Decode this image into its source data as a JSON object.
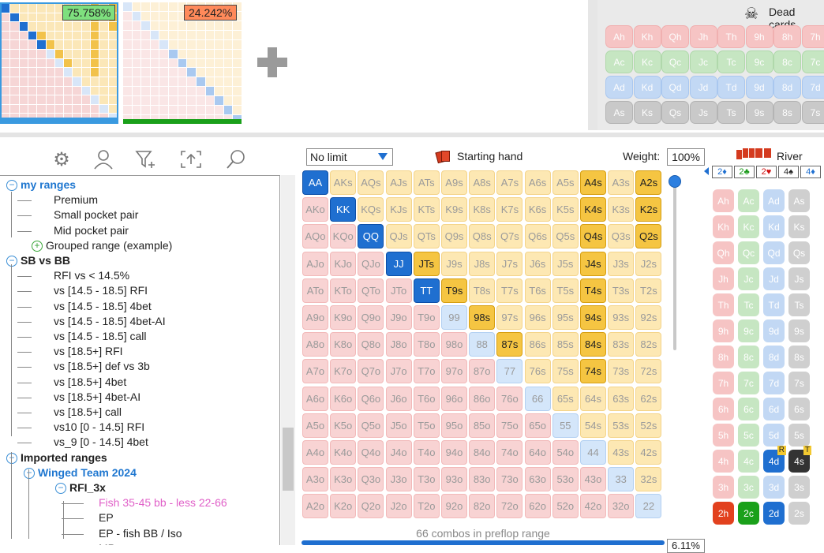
{
  "top": {
    "range1_pct": "75.758%",
    "range2_pct": "24.242%",
    "range1_badge_color": "#7ee07e",
    "range2_badge_color": "#ff8a5a",
    "plus_symbol": "+",
    "dead_cards_label": "Dead cards",
    "dead_cards": [
      [
        "Ah",
        "Kh",
        "Qh",
        "Jh",
        "Th",
        "9h",
        "8h",
        "7h"
      ],
      [
        "Ac",
        "Kc",
        "Qc",
        "Jc",
        "Tc",
        "9c",
        "8c",
        "7c"
      ],
      [
        "Ad",
        "Kd",
        "Qd",
        "Jd",
        "Td",
        "9d",
        "8d",
        "7d"
      ],
      [
        "As",
        "Ks",
        "Qs",
        "Js",
        "Ts",
        "9s",
        "8s",
        "7s"
      ]
    ]
  },
  "toolbar": {
    "icons": [
      "gear-icon",
      "user-icon",
      "filter-icon",
      "export-icon",
      "search-icon"
    ]
  },
  "tree": {
    "nodes": [
      {
        "label": "my ranges",
        "level": 0,
        "style": "folder-blue",
        "toggle": "minus"
      },
      {
        "label": "Premium",
        "level": 1
      },
      {
        "label": "Small pocket pair",
        "level": 1
      },
      {
        "label": "Mid pocket pair",
        "level": 1
      },
      {
        "label": "Grouped range (example)",
        "level": 1,
        "toggle": "plus"
      },
      {
        "label": "SB vs BB",
        "level": 0,
        "style": "folder",
        "toggle": "minus"
      },
      {
        "label": "RFI vs < 14.5%",
        "level": 1
      },
      {
        "label": "vs [14.5 - 18.5] RFI",
        "level": 1
      },
      {
        "label": "vs [14.5 - 18.5] 4bet",
        "level": 1
      },
      {
        "label": "vs [14.5 - 18.5] 4bet-AI",
        "level": 1
      },
      {
        "label": "vs [14.5 - 18.5] call",
        "level": 1
      },
      {
        "label": "vs [18.5+] RFI",
        "level": 1
      },
      {
        "label": "vs [18.5+] def vs 3b",
        "level": 1
      },
      {
        "label": "vs [18.5+] 4bet",
        "level": 1
      },
      {
        "label": "vs [18.5+] 4bet-AI",
        "level": 1
      },
      {
        "label": "vs [18.5+] call",
        "level": 1
      },
      {
        "label": "vs10 [0 - 14.5] RFI",
        "level": 1
      },
      {
        "label": "vs_9 [0 - 14.5] 4bet",
        "level": 1
      },
      {
        "label": "Imported ranges",
        "level": 0,
        "style": "folder",
        "toggle": "minus"
      },
      {
        "label": "Winged Team 2024",
        "level": 1,
        "style": "folder-blue",
        "toggle": "minus"
      },
      {
        "label": "RFI_3x",
        "level": 2,
        "style": "folder",
        "toggle": "minus"
      },
      {
        "label": "Fish 35-45 bb - less 22-66",
        "level": 3,
        "style": "pink"
      },
      {
        "label": "EP",
        "level": 3
      },
      {
        "label": "EP - fish BB / Iso",
        "level": 3
      },
      {
        "label": "MP",
        "level": 3
      }
    ]
  },
  "range": {
    "game_type": "No limit",
    "header_label": "Starting hand",
    "weight_label": "Weight:",
    "weight_value": "100%",
    "combos_text": "66 combos in preflop range",
    "percent_text": "6.11%",
    "grid": [
      [
        "AA",
        "AKs",
        "AQs",
        "AJs",
        "ATs",
        "A9s",
        "A8s",
        "A7s",
        "A6s",
        "A5s",
        "A4s",
        "A3s",
        "A2s"
      ],
      [
        "AKo",
        "KK",
        "KQs",
        "KJs",
        "KTs",
        "K9s",
        "K8s",
        "K7s",
        "K6s",
        "K5s",
        "K4s",
        "K3s",
        "K2s"
      ],
      [
        "AQo",
        "KQo",
        "QQ",
        "QJs",
        "QTs",
        "Q9s",
        "Q8s",
        "Q7s",
        "Q6s",
        "Q5s",
        "Q4s",
        "Q3s",
        "Q2s"
      ],
      [
        "AJo",
        "KJo",
        "QJo",
        "JJ",
        "JTs",
        "J9s",
        "J8s",
        "J7s",
        "J6s",
        "J5s",
        "J4s",
        "J3s",
        "J2s"
      ],
      [
        "ATo",
        "KTo",
        "QTo",
        "JTo",
        "TT",
        "T9s",
        "T8s",
        "T7s",
        "T6s",
        "T5s",
        "T4s",
        "T3s",
        "T2s"
      ],
      [
        "A9o",
        "K9o",
        "Q9o",
        "J9o",
        "T9o",
        "99",
        "98s",
        "97s",
        "96s",
        "95s",
        "94s",
        "93s",
        "92s"
      ],
      [
        "A8o",
        "K8o",
        "Q8o",
        "J8o",
        "T8o",
        "98o",
        "88",
        "87s",
        "86s",
        "85s",
        "84s",
        "83s",
        "82s"
      ],
      [
        "A7o",
        "K7o",
        "Q7o",
        "J7o",
        "T7o",
        "97o",
        "87o",
        "77",
        "76s",
        "75s",
        "74s",
        "73s",
        "72s"
      ],
      [
        "A6o",
        "K6o",
        "Q6o",
        "J6o",
        "T6o",
        "96o",
        "86o",
        "76o",
        "66",
        "65s",
        "64s",
        "63s",
        "62s"
      ],
      [
        "A5o",
        "K5o",
        "Q5o",
        "J5o",
        "T5o",
        "95o",
        "85o",
        "75o",
        "65o",
        "55",
        "54s",
        "53s",
        "52s"
      ],
      [
        "A4o",
        "K4o",
        "Q4o",
        "J4o",
        "T4o",
        "94o",
        "84o",
        "74o",
        "64o",
        "54o",
        "44",
        "43s",
        "42s"
      ],
      [
        "A3o",
        "K3o",
        "Q3o",
        "J3o",
        "T3o",
        "93o",
        "83o",
        "73o",
        "63o",
        "53o",
        "43o",
        "33",
        "32s"
      ],
      [
        "A2o",
        "K2o",
        "Q2o",
        "J2o",
        "T2o",
        "92o",
        "82o",
        "72o",
        "62o",
        "52o",
        "42o",
        "32o",
        "22"
      ]
    ],
    "selected": [
      "AA",
      "KK",
      "QQ",
      "JJ",
      "TT",
      "JTs",
      "T9s",
      "98s",
      "87s",
      "A4s",
      "K4s",
      "Q4s",
      "J4s",
      "T4s",
      "94s",
      "84s",
      "74s",
      "A2s",
      "K2s",
      "Q2s"
    ]
  },
  "river": {
    "label": "River",
    "board_cards": [
      "2♦",
      "2♣",
      "2♥",
      "4♠",
      "4♦"
    ],
    "ranks": [
      "A",
      "K",
      "Q",
      "J",
      "T",
      "9",
      "8",
      "7",
      "6",
      "5",
      "4",
      "3",
      "2"
    ],
    "suits": [
      "h",
      "c",
      "d",
      "s"
    ],
    "highlighted": [
      "4d",
      "4s",
      "2h",
      "2c",
      "2d"
    ],
    "badge_4d": "R",
    "badge_4s": "T"
  }
}
